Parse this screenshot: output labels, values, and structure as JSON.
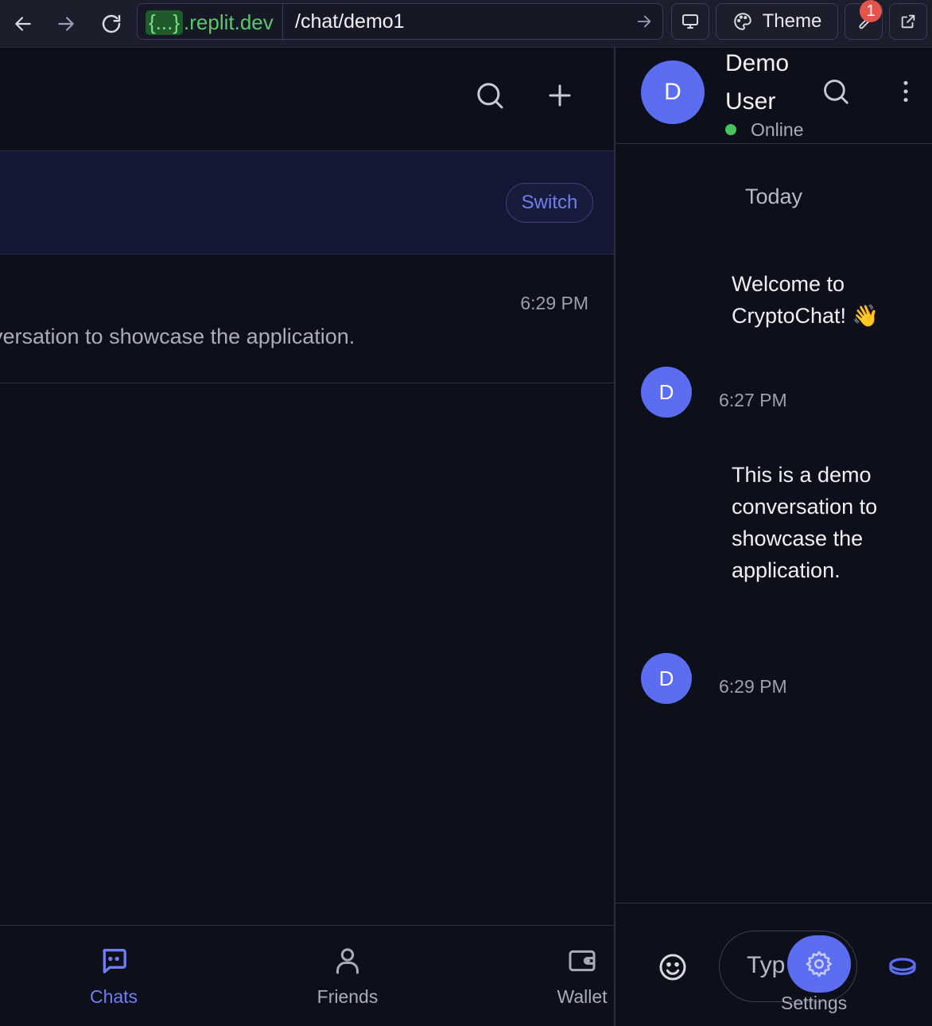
{
  "browser": {
    "domain_prefix": "{...}",
    "domain_suffix": ".replit.dev",
    "path": "/chat/demo1",
    "theme_label": "Theme",
    "badge_count": "1"
  },
  "chat_list": {
    "switch_label": "Switch",
    "row": {
      "time": "6:29 PM",
      "preview": "versation to showcase the application."
    }
  },
  "bottom_nav": {
    "items": [
      {
        "label": "Chats",
        "icon": "chat-bubble-icon",
        "active": true
      },
      {
        "label": "Friends",
        "icon": "user-icon",
        "active": false
      },
      {
        "label": "Wallet",
        "icon": "wallet-icon",
        "active": false
      }
    ]
  },
  "conversation": {
    "contact": {
      "avatar_letter": "D",
      "name": "Demo User",
      "status": "Online"
    },
    "day_label": "Today",
    "messages": [
      {
        "avatar_letter": "D",
        "text": "Welcome to CryptoChat! 👋",
        "time": "6:27 PM"
      },
      {
        "avatar_letter": "D",
        "text": "This is a demo conversation to showcase the application.",
        "time": "6:29 PM"
      }
    ],
    "composer": {
      "placeholder": "Typ",
      "settings_label": "Settings"
    }
  },
  "colors": {
    "background": "#0d0f1a",
    "accent": "#5b6df0",
    "online": "#46c35a",
    "banner": "#131834"
  }
}
